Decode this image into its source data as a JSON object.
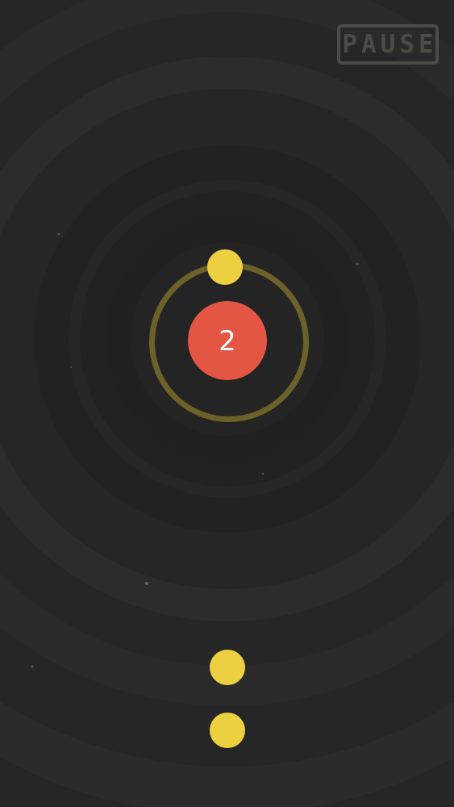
{
  "pause_label": "PAUSE",
  "score": "2",
  "colors": {
    "background": "#272627",
    "core": "#e45644",
    "ball": "#ecd03f",
    "ring": "#6c6229",
    "pause": "#4c4b48"
  },
  "balls": {
    "attached_count": 1,
    "queue_count": 2
  }
}
